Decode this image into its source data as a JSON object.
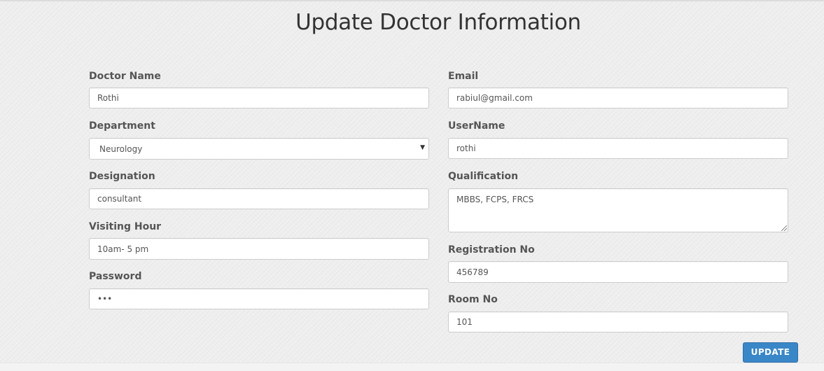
{
  "page": {
    "title": "Update Doctor Information"
  },
  "form": {
    "doctor_name": {
      "label": "Doctor Name",
      "value": "Rothi"
    },
    "department": {
      "label": "Department",
      "value": "Neurology"
    },
    "designation": {
      "label": "Designation",
      "value": "consultant"
    },
    "visiting_hour": {
      "label": "Visiting Hour",
      "value": "10am- 5 pm"
    },
    "password": {
      "label": "Password",
      "value": "•••"
    },
    "email": {
      "label": "Email",
      "value": "rabiul@gmail.com"
    },
    "username": {
      "label": "UserName",
      "value": "rothi"
    },
    "qualification": {
      "label": "Qualification",
      "value": "MBBS, FCPS, FRCS"
    },
    "registration_no": {
      "label": "Registration No",
      "value": "456789"
    },
    "room_no": {
      "label": "Room No",
      "value": "101"
    },
    "submit_label": "UPDATE"
  },
  "icons": {
    "select_arrow": "dropdown-caret-icon",
    "textarea_grip": "resize-grip-icon"
  },
  "colors": {
    "accent": "#3a87c8",
    "background": "#eeeeee",
    "title": "#333333",
    "label": "#555555"
  }
}
